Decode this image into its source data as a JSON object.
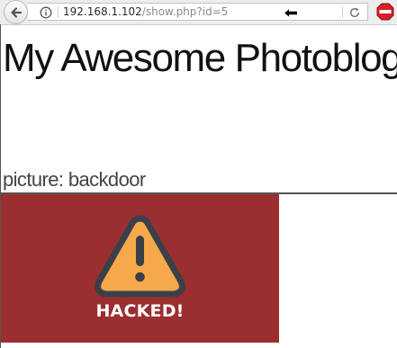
{
  "browser": {
    "url_host": "192.168.1.102",
    "url_path": "/show.php?id=5"
  },
  "page": {
    "title": "My Awesome Photoblog",
    "picture_label": "picture: backdoor",
    "image_text": "HACKED!"
  },
  "colors": {
    "image_background": "#9b2f2f",
    "warning_fill": "#f6a94b",
    "warning_outline": "#3b4048"
  },
  "icons": [
    "back-arrow-icon",
    "info-icon",
    "mouse-cursor-icon",
    "reload-icon",
    "stop-icon",
    "warning-icon"
  ]
}
